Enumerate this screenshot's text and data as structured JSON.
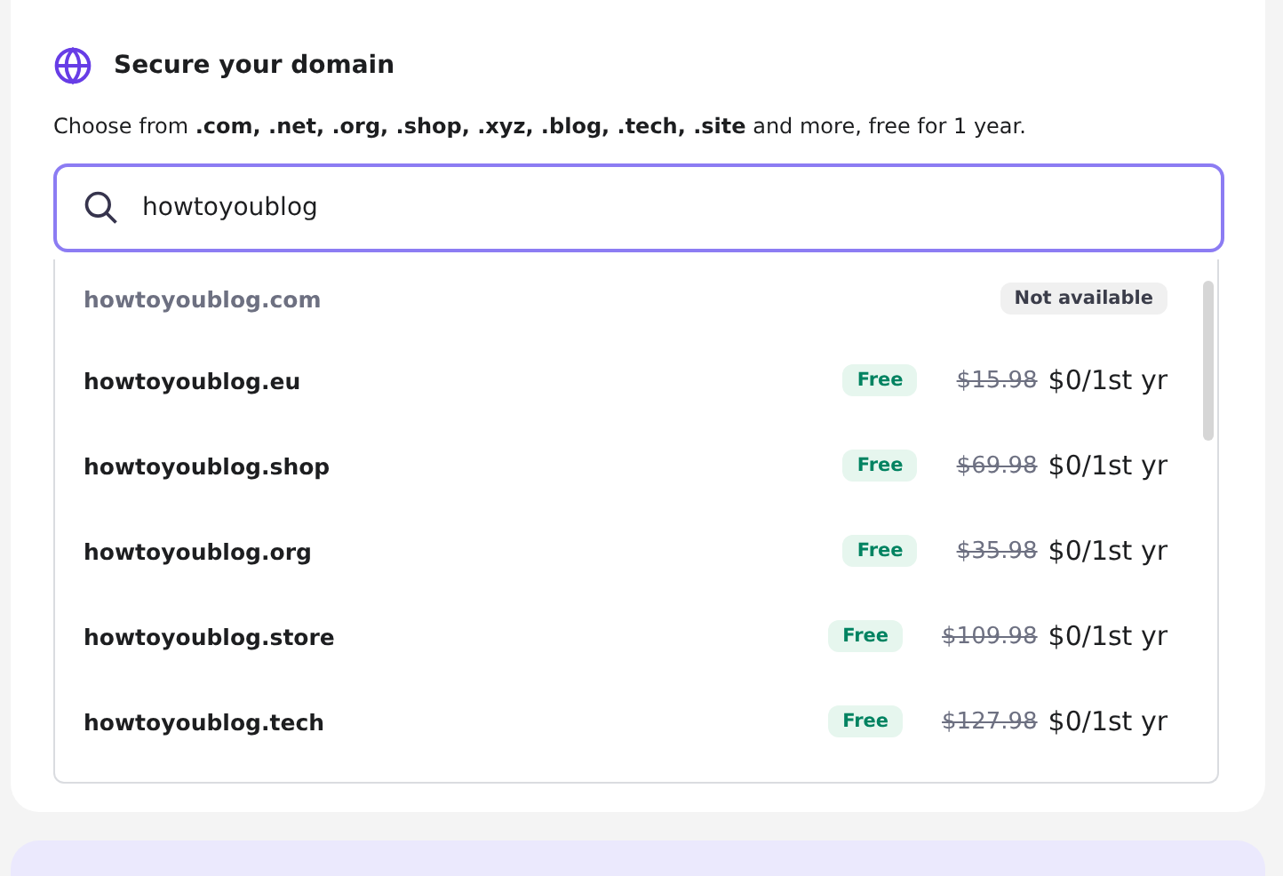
{
  "title": "Secure your domain",
  "description": "Choose from **.com, .net, .org, .shop, .xyz, .blog, .tech, .site** and more, free for 1 year.",
  "search": {
    "value": "howtoyoublog"
  },
  "results": [
    {
      "domain": "howtoyoublog.com",
      "available": false,
      "badge": "Not available"
    },
    {
      "domain": "howtoyoublog.eu",
      "available": true,
      "badge": "Free",
      "old_price": "$15.98",
      "price": "$0/1st yr"
    },
    {
      "domain": "howtoyoublog.shop",
      "available": true,
      "badge": "Free",
      "old_price": "$69.98",
      "price": "$0/1st yr"
    },
    {
      "domain": "howtoyoublog.org",
      "available": true,
      "badge": "Free",
      "old_price": "$35.98",
      "price": "$0/1st yr"
    },
    {
      "domain": "howtoyoublog.store",
      "available": true,
      "badge": "Free",
      "old_price": "$109.98",
      "price": "$0/1st yr"
    },
    {
      "domain": "howtoyoublog.tech",
      "available": true,
      "badge": "Free",
      "old_price": "$127.98",
      "price": "$0/1st yr"
    }
  ]
}
